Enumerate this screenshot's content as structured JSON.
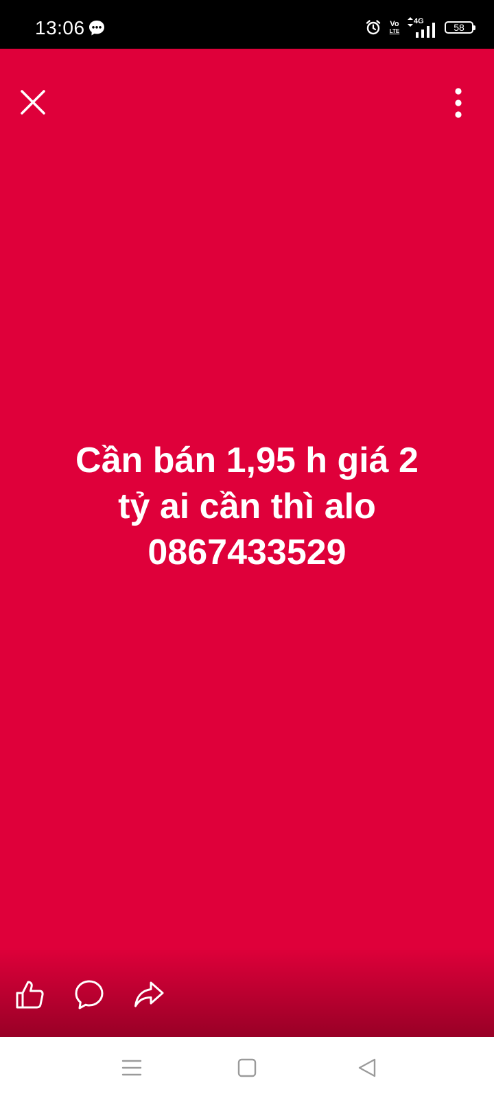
{
  "status_bar": {
    "time": "13:06",
    "message_icon": "messenger-bubble-icon",
    "alarm_icon": "alarm-clock-icon",
    "volte_top": "Vo",
    "volte_bottom": "LTE",
    "network_label": "4G",
    "signal_icon": "signal-bars-icon",
    "battery_level": "58"
  },
  "story": {
    "background_color": "#df003a",
    "close_icon": "close-icon",
    "more_icon": "more-vertical-icon",
    "text_lines": [
      "Cần bán 1,95 h giá 2",
      "tỷ ai cần thì alo",
      "0867433529"
    ],
    "actions": {
      "like_icon": "thumbs-up-icon",
      "comment_icon": "comment-bubble-icon",
      "share_icon": "share-arrow-icon"
    }
  },
  "nav_bar": {
    "recents_icon": "menu-lines-icon",
    "home_icon": "home-square-icon",
    "back_icon": "back-triangle-icon"
  }
}
